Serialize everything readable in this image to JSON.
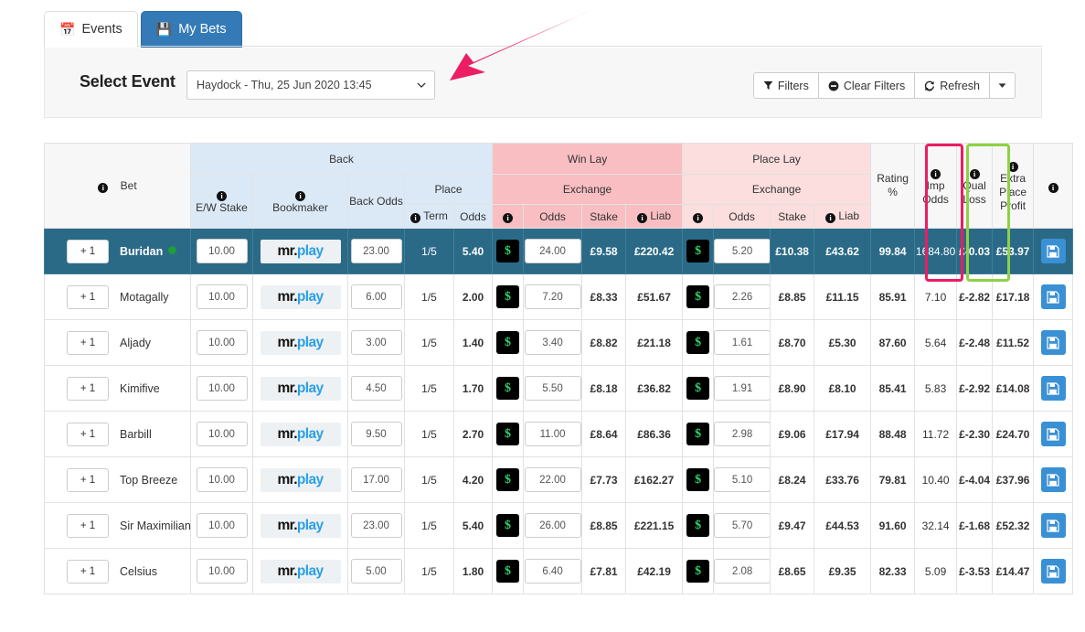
{
  "tabs": [
    {
      "label": "Events",
      "icon": "calendar-icon",
      "active": true
    },
    {
      "label": "My Bets",
      "icon": "save-icon",
      "active": false
    }
  ],
  "event_panel": {
    "label": "Select Event",
    "selected_event": "Haydock - Thu, 25 Jun 2020 13:45",
    "buttons": [
      {
        "label": "Filters",
        "icon": "funnel-icon"
      },
      {
        "label": "Clear Filters",
        "icon": "minus-circle-icon"
      },
      {
        "label": "Refresh",
        "icon": "refresh-icon"
      }
    ],
    "dropdown_caret": "caret-down-icon"
  },
  "table": {
    "groups": {
      "bet": "Bet",
      "back": "Back",
      "win_lay": "Win Lay",
      "place_lay": "Place Lay"
    },
    "sub": {
      "place": "Place",
      "exchange": "Exchange"
    },
    "columns": {
      "ew_stake": "E/W Stake",
      "bookmaker": "Bookmaker",
      "back_odds": "Back Odds",
      "term": "Term",
      "odds": "Odds",
      "stake": "Stake",
      "liab": "Liab",
      "rating": "Rating %",
      "imp_odds": "Imp Odds",
      "qual_loss": "Qual Loss",
      "extra_place_profit": "Extra Place Profit"
    },
    "rows": [
      {
        "add": "+ 1",
        "name": "Buridan",
        "indicator": "green-dot",
        "ew_stake": "10.00",
        "bookmaker": "mr.play",
        "back_odds": "23.00",
        "term": "1/5",
        "place_odds": "5.40",
        "win_ex": "$",
        "win_odds": "24.00",
        "win_stake": "£9.58",
        "win_liab": "£220.42",
        "place_ex": "$",
        "place_lay_odds": "5.20",
        "place_stake": "£10.38",
        "place_liab": "£43.62",
        "rating": "99.84",
        "imp_odds": "1684.80",
        "qual_loss": "£-0.03",
        "extra_place_profit": "£53.97",
        "selected": true
      },
      {
        "add": "+ 1",
        "name": "Motagally",
        "indicator": "",
        "ew_stake": "10.00",
        "bookmaker": "mr.play",
        "back_odds": "6.00",
        "term": "1/5",
        "place_odds": "2.00",
        "win_ex": "$",
        "win_odds": "7.20",
        "win_stake": "£8.33",
        "win_liab": "£51.67",
        "place_ex": "$",
        "place_lay_odds": "2.26",
        "place_stake": "£8.85",
        "place_liab": "£11.15",
        "rating": "85.91",
        "imp_odds": "7.10",
        "qual_loss": "£-2.82",
        "extra_place_profit": "£17.18",
        "selected": false
      },
      {
        "add": "+ 1",
        "name": "Aljady",
        "indicator": "",
        "ew_stake": "10.00",
        "bookmaker": "mr.play",
        "back_odds": "3.00",
        "term": "1/5",
        "place_odds": "1.40",
        "win_ex": "$",
        "win_odds": "3.40",
        "win_stake": "£8.82",
        "win_liab": "£21.18",
        "place_ex": "$",
        "place_lay_odds": "1.61",
        "place_stake": "£8.70",
        "place_liab": "£5.30",
        "rating": "87.60",
        "imp_odds": "5.64",
        "qual_loss": "£-2.48",
        "extra_place_profit": "£11.52",
        "selected": false
      },
      {
        "add": "+ 1",
        "name": "Kimifive",
        "indicator": "",
        "ew_stake": "10.00",
        "bookmaker": "mr.play",
        "back_odds": "4.50",
        "term": "1/5",
        "place_odds": "1.70",
        "win_ex": "$",
        "win_odds": "5.50",
        "win_stake": "£8.18",
        "win_liab": "£36.82",
        "place_ex": "$",
        "place_lay_odds": "1.91",
        "place_stake": "£8.90",
        "place_liab": "£8.10",
        "rating": "85.41",
        "imp_odds": "5.83",
        "qual_loss": "£-2.92",
        "extra_place_profit": "£14.08",
        "selected": false
      },
      {
        "add": "+ 1",
        "name": "Barbill",
        "indicator": "",
        "ew_stake": "10.00",
        "bookmaker": "mr.play",
        "back_odds": "9.50",
        "term": "1/5",
        "place_odds": "2.70",
        "win_ex": "$",
        "win_odds": "11.00",
        "win_stake": "£8.64",
        "win_liab": "£86.36",
        "place_ex": "$",
        "place_lay_odds": "2.98",
        "place_stake": "£9.06",
        "place_liab": "£17.94",
        "rating": "88.48",
        "imp_odds": "11.72",
        "qual_loss": "£-2.30",
        "extra_place_profit": "£24.70",
        "selected": false
      },
      {
        "add": "+ 1",
        "name": "Top Breeze",
        "indicator": "",
        "ew_stake": "10.00",
        "bookmaker": "mr.play",
        "back_odds": "17.00",
        "term": "1/5",
        "place_odds": "4.20",
        "win_ex": "$",
        "win_odds": "22.00",
        "win_stake": "£7.73",
        "win_liab": "£162.27",
        "place_ex": "$",
        "place_lay_odds": "5.10",
        "place_stake": "£8.24",
        "place_liab": "£33.76",
        "rating": "79.81",
        "imp_odds": "10.40",
        "qual_loss": "£-4.04",
        "extra_place_profit": "£37.96",
        "selected": false
      },
      {
        "add": "+ 1",
        "name": "Sir Maximilian",
        "indicator": "",
        "ew_stake": "10.00",
        "bookmaker": "mr.play",
        "back_odds": "23.00",
        "term": "1/5",
        "place_odds": "5.40",
        "win_ex": "$",
        "win_odds": "26.00",
        "win_stake": "£8.85",
        "win_liab": "£221.15",
        "place_ex": "$",
        "place_lay_odds": "5.70",
        "place_stake": "£9.47",
        "place_liab": "£44.53",
        "rating": "91.60",
        "imp_odds": "32.14",
        "qual_loss": "£-1.68",
        "extra_place_profit": "£52.32",
        "selected": false
      },
      {
        "add": "+ 1",
        "name": "Celsius",
        "indicator": "",
        "ew_stake": "10.00",
        "bookmaker": "mr.play",
        "back_odds": "5.00",
        "term": "1/5",
        "place_odds": "1.80",
        "win_ex": "$",
        "win_odds": "6.40",
        "win_stake": "£7.81",
        "win_liab": "£42.19",
        "place_ex": "$",
        "place_lay_odds": "2.08",
        "place_stake": "£8.65",
        "place_liab": "£9.35",
        "rating": "82.33",
        "imp_odds": "5.09",
        "qual_loss": "£-3.53",
        "extra_place_profit": "£14.47",
        "selected": false
      }
    ]
  },
  "annotations": {
    "arrow_color": "#ec1d62",
    "qual_loss_highlight_color": "#ec1d62",
    "extra_place_profit_highlight_color": "#8ed143"
  }
}
